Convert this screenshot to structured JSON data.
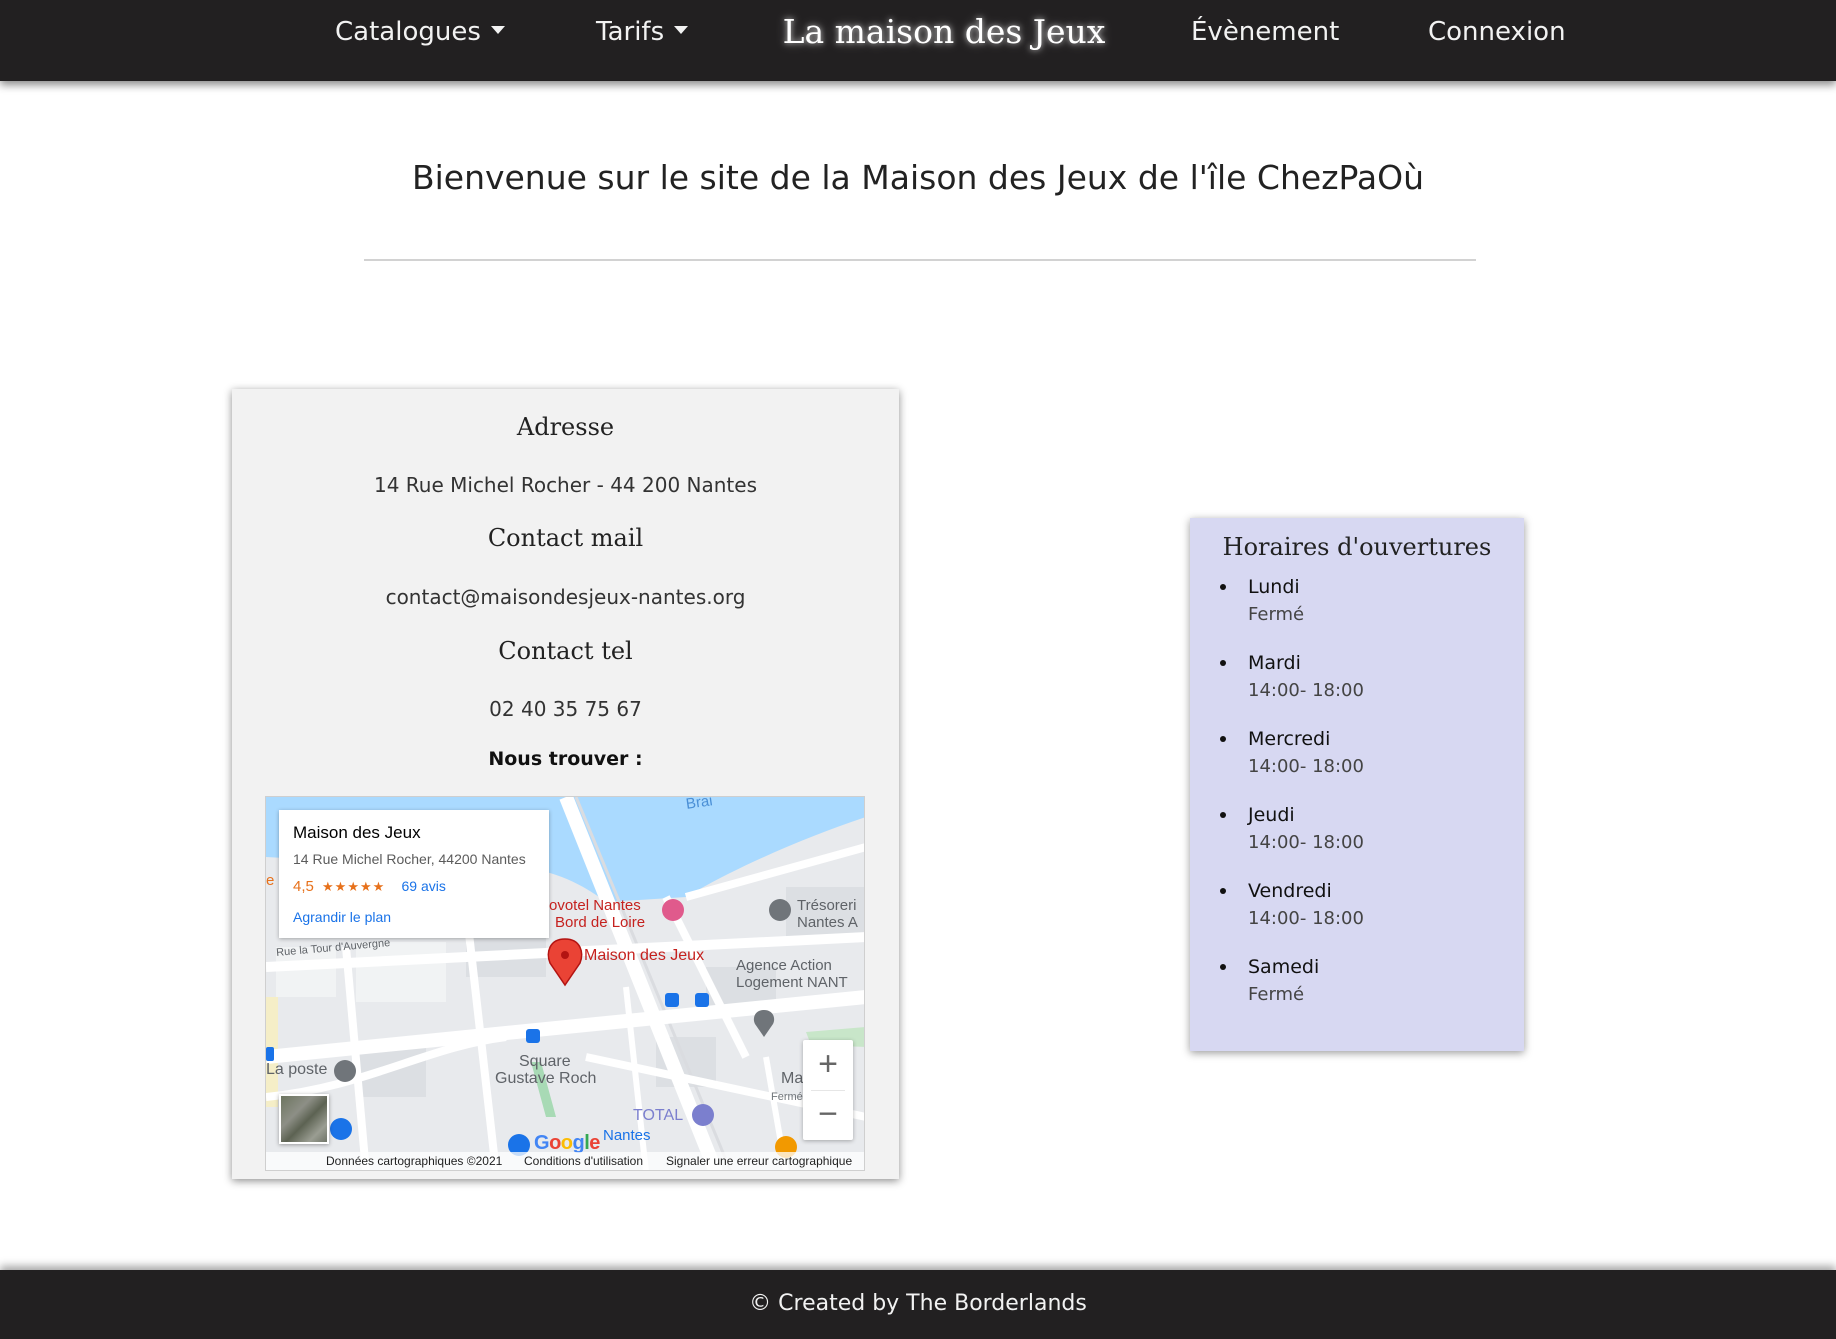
{
  "nav": {
    "catalogues": "Catalogues",
    "tarifs": "Tarifs",
    "brand": "La maison des Jeux",
    "event": "Évènement",
    "login": "Connexion"
  },
  "header": {
    "title": "Bienvenue sur le site de la Maison des Jeux de l'île ChezPaOù"
  },
  "contact": {
    "address_heading": "Adresse",
    "address": "14 Rue Michel Rocher - 44 200 Nantes",
    "mail_heading": "Contact mail",
    "mail": "contact@maisondesjeux-nantes.org",
    "tel_heading": "Contact tel",
    "tel": "02 40 35 75 67",
    "find_us": "Nous trouver :"
  },
  "map": {
    "info_title": "Maison des Jeux",
    "info_address": "14 Rue Michel Rocher, 44200 Nantes",
    "rating": "4,5",
    "stars": "★★★★★",
    "reviews": "69 avis",
    "enlarge": "Agrandir le plan",
    "pin_label": "Maison des Jeux",
    "labels": {
      "novotel": "ovotel Nantes",
      "bord_loire": "Bord de Loire",
      "tresorerie": "Trésoreri",
      "nantes_a": "Nantes A",
      "agence": "Agence Action",
      "logement": "Logement NANT",
      "street": "Rue la Tour d'Auvergne",
      "la_poste": "La poste",
      "square": "Square",
      "gustave": "Gustave Roch",
      "total": "TOTAL",
      "nantes": "Nantes",
      "brai": "Brai",
      "ma": "Ma",
      "ferme": "Fermé",
      "e_left": "e"
    },
    "zoom_in": "+",
    "zoom_out": "−",
    "google": [
      "G",
      "o",
      "o",
      "g",
      "l",
      "e"
    ],
    "footer_data": "Données cartographiques ©2021",
    "footer_terms": "Conditions d'utilisation",
    "footer_report": "Signaler une erreur cartographique",
    "colors": {
      "water": "#aadaff",
      "land": "#e8eaed",
      "road": "#ffffff",
      "pin": "#ea4335",
      "poi_blue": "#1a73e8",
      "poi_grey": "#70757a",
      "poi_pink": "#e05a8c"
    }
  },
  "hours": {
    "title": "Horaires d'ouvertures",
    "days": [
      {
        "day": "Lundi",
        "time": "Fermé"
      },
      {
        "day": "Mardi",
        "time": "14:00- 18:00"
      },
      {
        "day": "Mercredi",
        "time": "14:00- 18:00"
      },
      {
        "day": "Jeudi",
        "time": "14:00- 18:00"
      },
      {
        "day": "Vendredi",
        "time": "14:00- 18:00"
      },
      {
        "day": "Samedi",
        "time": "Fermé"
      }
    ]
  },
  "footer": {
    "text": "© Created by The Borderlands"
  },
  "colors": {
    "navbar_bg": "#222021",
    "contact_bg": "#f2f2f2",
    "hours_bg": "#d7d8f2"
  }
}
